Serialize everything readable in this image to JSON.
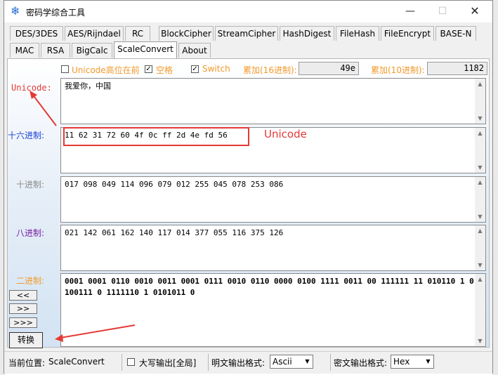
{
  "window": {
    "title": "密码学综合工具",
    "icon": "snowflake-icon"
  },
  "tabs_row1": [
    "DES/3DES",
    "AES/Rijndael",
    "RC",
    "BlockCipher",
    "StreamCipher",
    "HashDigest",
    "FileHash",
    "FileEncrypt",
    "BASE-N"
  ],
  "tabs_row2": [
    "MAC",
    "RSA",
    "BigCalc",
    "ScaleConvert",
    "About"
  ],
  "active_tab": "ScaleConvert",
  "options": {
    "unicode_high_first": {
      "label": "Unicode高位在前",
      "checked": false
    },
    "space": {
      "label": "空格",
      "checked": true
    },
    "switch": {
      "label": "Switch",
      "checked": true
    },
    "sum16_label": "累加(16进制):",
    "sum16_value": "49e",
    "sum10_label": "累加(10进制):",
    "sum10_value": "1182"
  },
  "fields": {
    "unicode": {
      "label": "Unicode:",
      "value": "我爱你，中国"
    },
    "hex": {
      "label": "十六进制:",
      "value": "11 62 31 72 60 4f 0c ff 2d 4e fd 56"
    },
    "dec": {
      "label": "十进制:",
      "value": "017 098 049 114 096 079 012 255 045 078 253 086"
    },
    "oct": {
      "label": "八进制:",
      "value": "021 142 061 162 140 117 014 377 055 116 375 126"
    },
    "bin": {
      "label": "二进制:",
      "value": "0001 0001 0110 0010 0011 0001 0111 0010 0110 0000 0100 1111 0011 00 111111 11 010110 1 0100111 0 1111110 1 0101011 0"
    }
  },
  "buttons": {
    "prev": "<<",
    "next": ">>",
    "last": ">>>",
    "convert": "转换"
  },
  "statusbar": {
    "location_label": "当前位置:",
    "location_value": "ScaleConvert",
    "uppercase_label": "大写输出[全局]",
    "uppercase_checked": false,
    "plain_fmt_label": "明文输出格式:",
    "plain_fmt_value": "Ascii",
    "cipher_fmt_label": "密文输出格式:",
    "cipher_fmt_value": "Hex"
  },
  "annotation": {
    "text": "Unicode",
    "color": "#e53935"
  },
  "colors": {
    "unicode_label": "#e53935",
    "hex_label": "#1a3fd6",
    "dec_label": "#8a8a8a",
    "oct_label": "#7a1fa2",
    "bin_label": "#f39a2b",
    "options": "#f39a2b"
  }
}
